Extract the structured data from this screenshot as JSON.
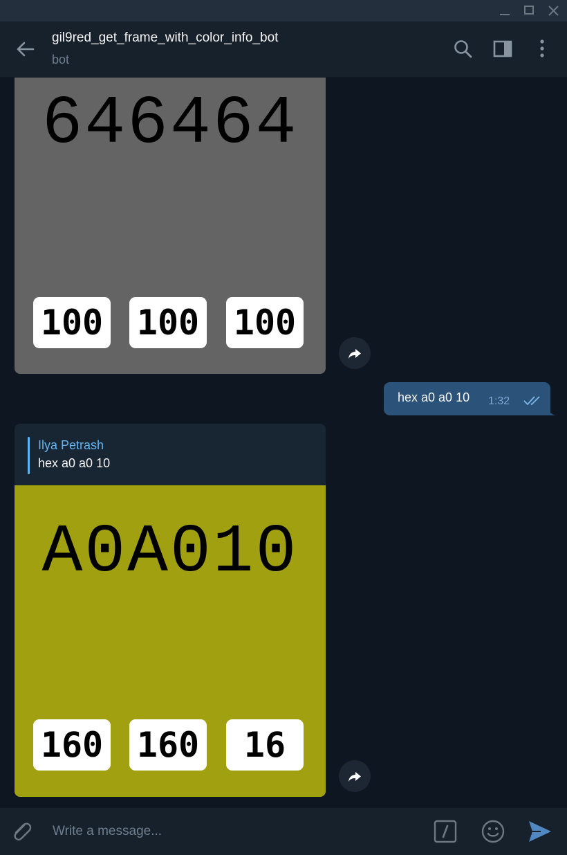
{
  "window": {
    "controls": [
      "minimize-icon",
      "maximize-icon",
      "close-icon"
    ]
  },
  "header": {
    "title": "gil9red_get_frame_with_color_info_bot",
    "subtitle": "bot",
    "icons": [
      "back-arrow-icon",
      "search-icon",
      "sidebar-toggle-icon",
      "more-vertical-icon"
    ]
  },
  "messages": [
    {
      "type": "bot-photo",
      "hex": "646464",
      "rgb": [
        "100",
        "100",
        "100"
      ],
      "background": "#646464"
    },
    {
      "type": "outgoing-text",
      "text": "hex a0 a0 10",
      "time": "1:32",
      "status": "read-double-check-icon"
    },
    {
      "type": "bot-photo-reply",
      "reply_to_name": "Ilya Petrash",
      "reply_to_text": "hex a0 a0 10",
      "hex": "A0A010",
      "rgb": [
        "160",
        "160",
        "16"
      ],
      "background": "#a0a010"
    }
  ],
  "composer": {
    "placeholder": "Write a message...",
    "icons": [
      "attach-icon",
      "bot-command-icon",
      "emoji-icon",
      "send-icon"
    ]
  },
  "colors": {
    "window_bg": "#0e1621",
    "header_bg": "#17212b",
    "outgoing_bubble": "#2b5278",
    "accent": "#64b5ef",
    "send_icon": "#5288c1"
  }
}
